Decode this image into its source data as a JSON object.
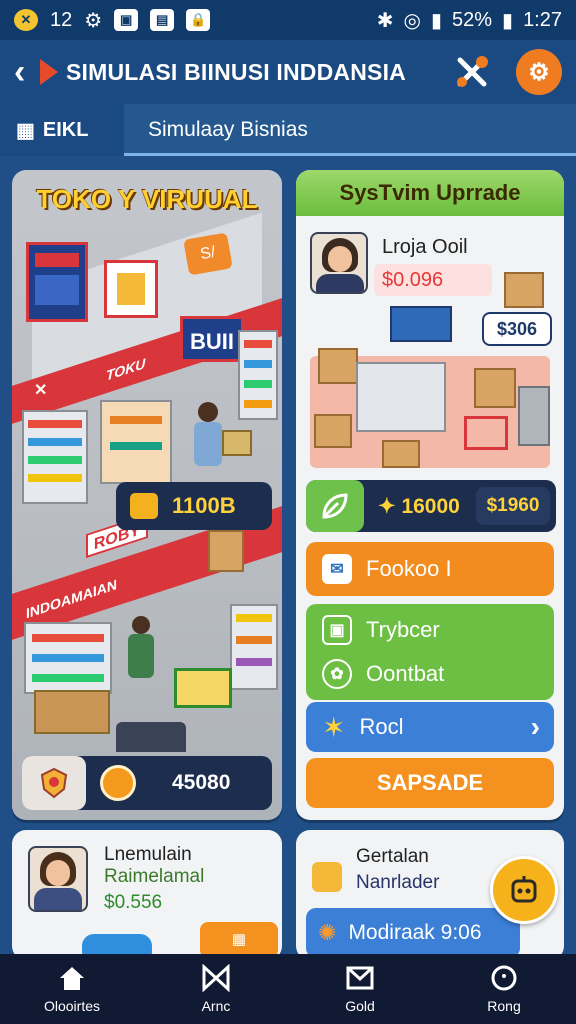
{
  "status_bar": {
    "notif_count": "12",
    "battery": "52%",
    "time": "1:27"
  },
  "header": {
    "title": "SIMULASI BIINUSI INDDANSIA"
  },
  "tabs": {
    "left_label": "EIKL",
    "right_label": "Simulaay Bisnias"
  },
  "left_panel": {
    "title": "TOKO Y VIRUUAL",
    "sign_bui": "BUII",
    "sign_toko": "TOKU",
    "sign_inda": "INDOAMAIAN",
    "sign_rok": "ROBY",
    "price_value": "1100B",
    "bottom_value": "45080"
  },
  "right_panel": {
    "title": "SysTvim Uprrade",
    "name": "Lroja Ooil",
    "price": "$0.096",
    "tag": "$306",
    "stat_value": "16000",
    "stat_secondary": "$1960",
    "buttons": {
      "orange": "Fookoo I",
      "green_1": "Trybcer",
      "green_2": "Oontbat",
      "blue": "Rocl",
      "cta": "SAPSADE"
    }
  },
  "lower_left": {
    "line1": "Lnemulain",
    "line2": "Raimelamal",
    "line3": "$0.556"
  },
  "lower_right": {
    "line1": "Gertalan",
    "line2": "Nanrlader",
    "blue_label": "Modiraak 9:06"
  },
  "nav": [
    {
      "label": "Olooirtes",
      "icon": "home-icon"
    },
    {
      "label": "Arnc",
      "icon": "bowtie-icon"
    },
    {
      "label": "Gold",
      "icon": "mail-icon"
    },
    {
      "label": "Rong",
      "icon": "profile-icon"
    }
  ],
  "colors": {
    "primary": "#1b4a82",
    "accent_orange": "#f28c1e",
    "accent_green": "#6cbf43",
    "accent_blue": "#3c7fd6",
    "gold_text": "#ffd23c"
  }
}
